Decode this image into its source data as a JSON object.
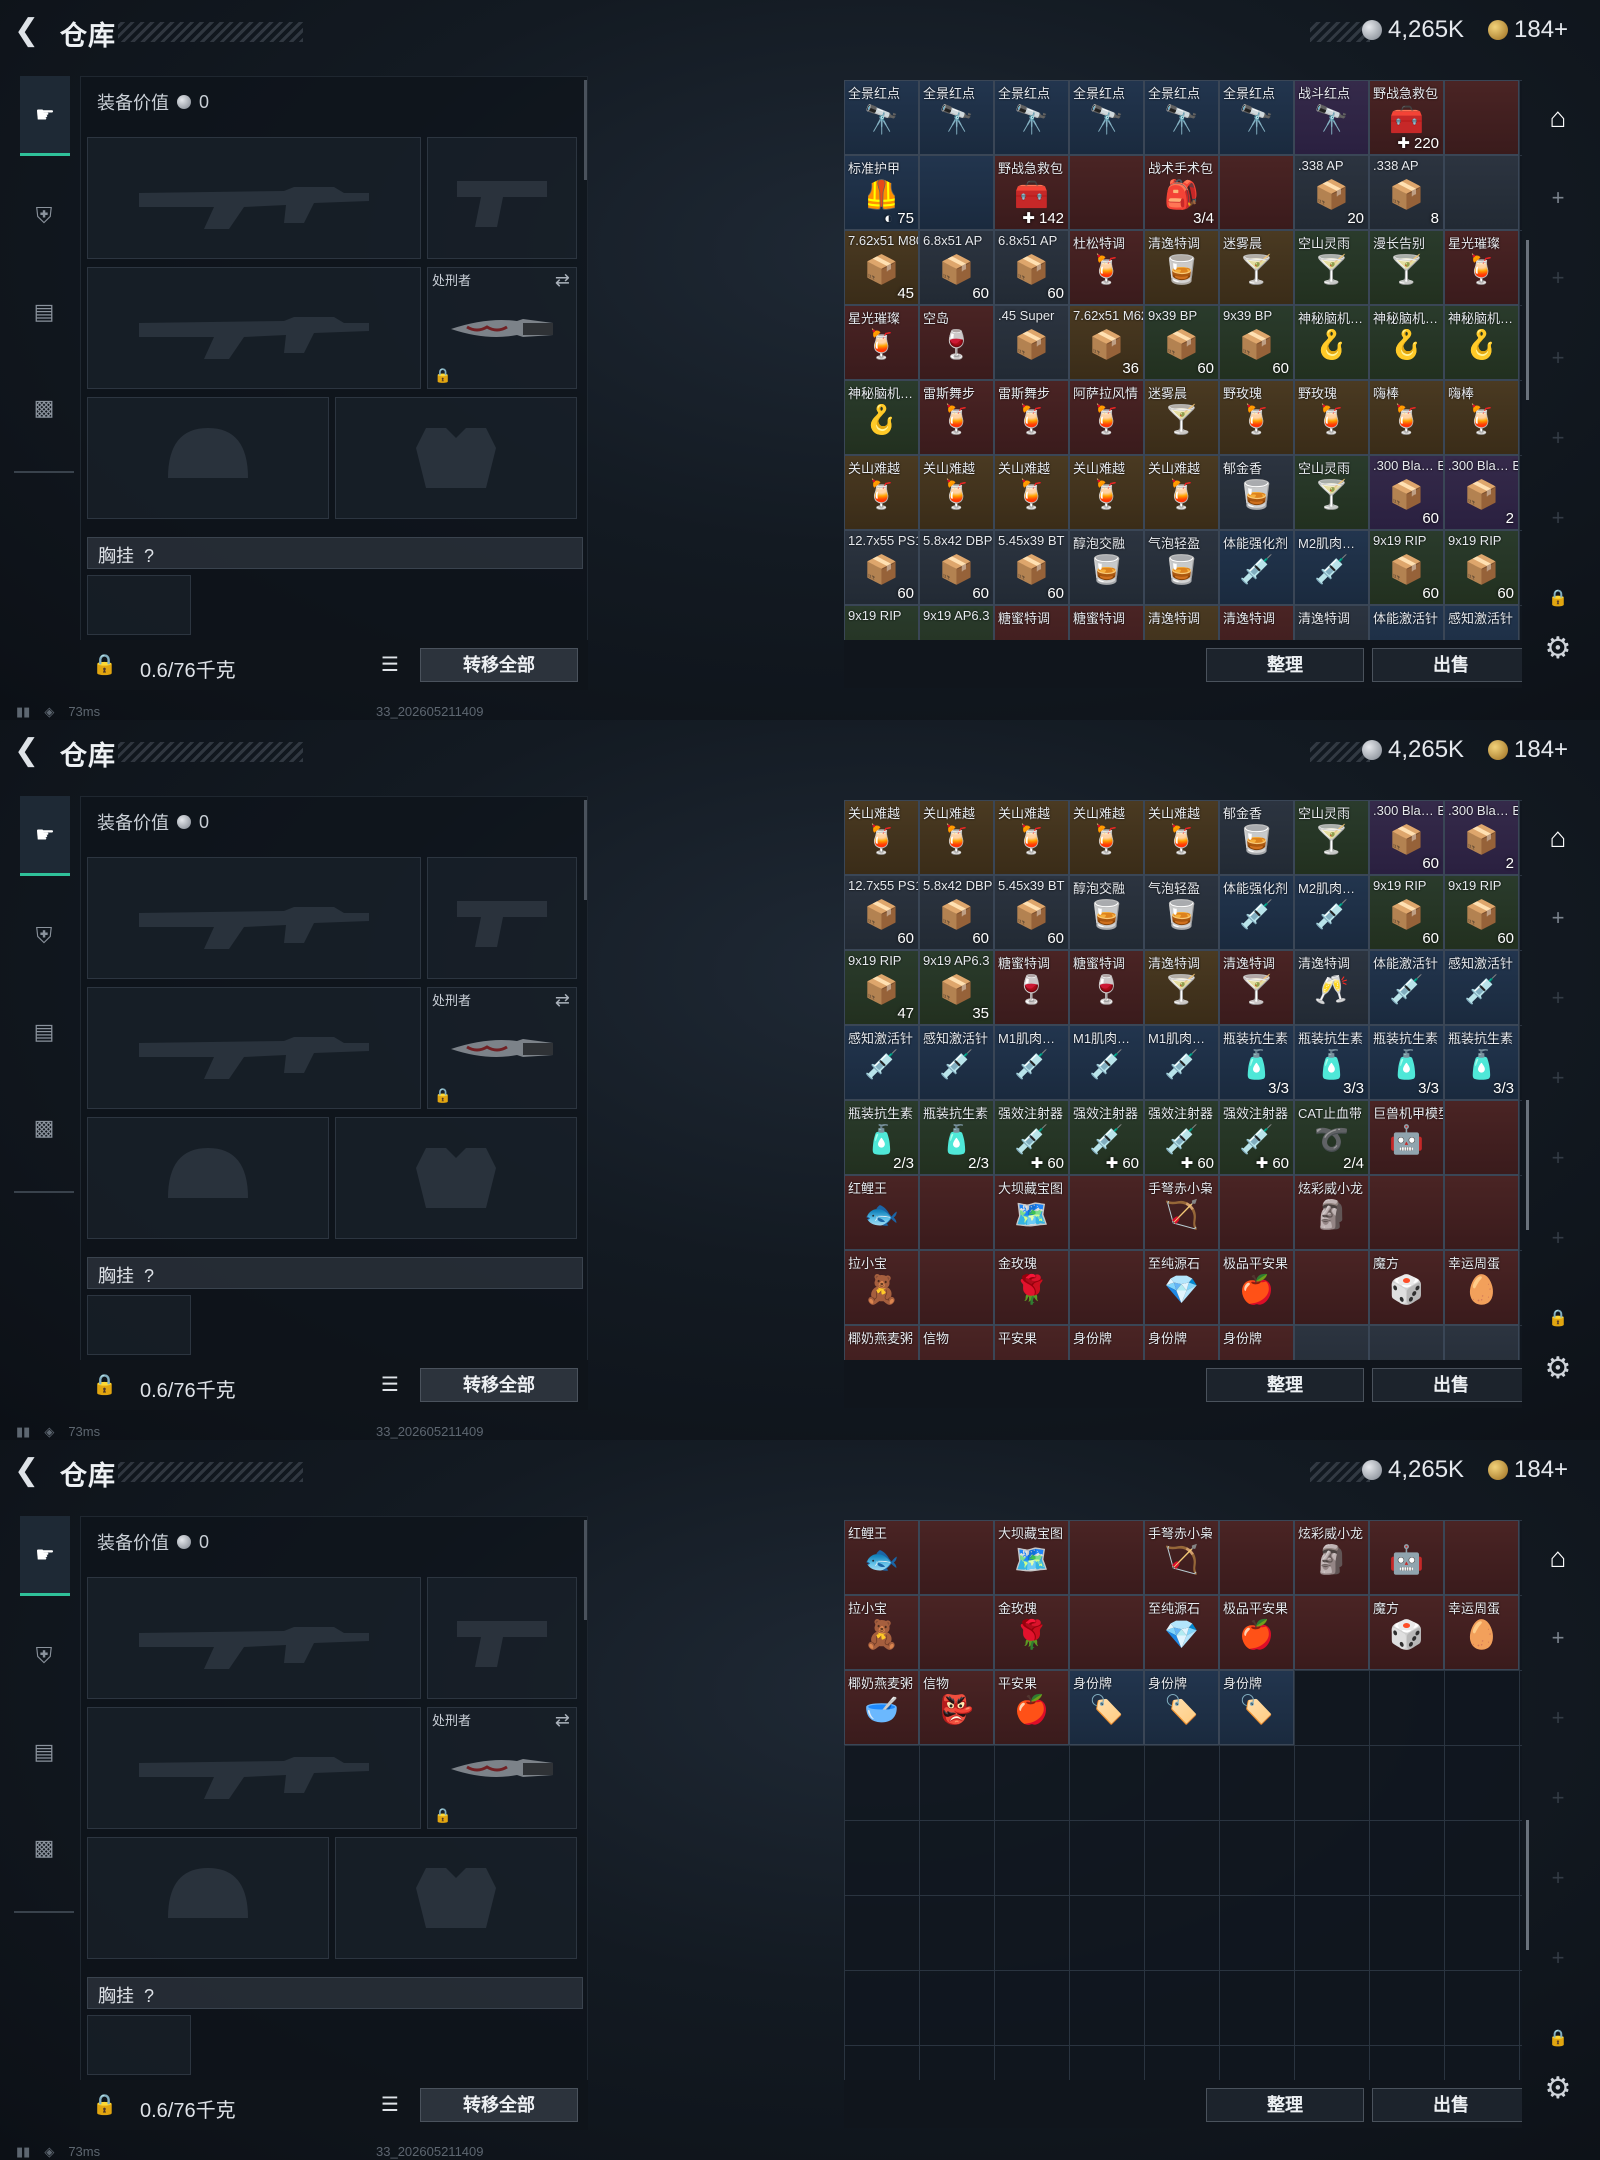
{
  "screens": [
    {
      "stash_cells": [
        {
          "n": "全景红点",
          "c": "",
          "t": "bl",
          "i": "🔭"
        },
        {
          "n": "全景红点",
          "c": "",
          "t": "bl",
          "i": "🔭"
        },
        {
          "n": "全景红点",
          "c": "",
          "t": "bl",
          "i": "🔭"
        },
        {
          "n": "全景红点",
          "c": "",
          "t": "bl",
          "i": "🔭"
        },
        {
          "n": "全景红点",
          "c": "",
          "t": "bl",
          "i": "🔭"
        },
        {
          "n": "全景红点",
          "c": "",
          "t": "bl",
          "i": "🔭"
        },
        {
          "n": "战斗红点",
          "c": "",
          "t": "pr",
          "i": "🔭"
        },
        {
          "n": "野战急救包",
          "c": "✚ 220",
          "t": "rd",
          "i": "🧰"
        },
        {
          "n": "",
          "c": "",
          "t": "rd",
          "i": ""
        },
        {
          "n": "标准护甲",
          "c": "◐ 75",
          "t": "bl",
          "i": "🦺"
        },
        {
          "n": "",
          "c": "",
          "t": "bl",
          "i": ""
        },
        {
          "n": "野战急救包",
          "c": "✚ 142",
          "t": "rd",
          "i": "🧰"
        },
        {
          "n": "",
          "c": "",
          "t": "rd",
          "i": ""
        },
        {
          "n": "战术手术包",
          "c": "3/4",
          "t": "rd",
          "i": "🎒"
        },
        {
          "n": "",
          "c": "",
          "t": "rd",
          "i": ""
        },
        {
          "n": ".338 AP",
          "c": "20",
          "t": "gy",
          "i": "📦"
        },
        {
          "n": ".338 AP",
          "c": "8",
          "t": "gy",
          "i": "📦"
        },
        {
          "n": "",
          "c": "",
          "t": "gy",
          "i": ""
        },
        {
          "n": "7.62x51 M80",
          "c": "45",
          "t": "gd",
          "i": "📦"
        },
        {
          "n": "6.8x51 AP",
          "c": "60",
          "t": "gy",
          "i": "📦"
        },
        {
          "n": "6.8x51 AP",
          "c": "60",
          "t": "gy",
          "i": "📦"
        },
        {
          "n": "杜松特调",
          "c": "",
          "t": "rd",
          "i": "🍹"
        },
        {
          "n": "清逸特调",
          "c": "",
          "t": "gd",
          "i": "🥃"
        },
        {
          "n": "迷雾晨",
          "c": "",
          "t": "gd",
          "i": "🍸"
        },
        {
          "n": "空山灵雨",
          "c": "",
          "t": "gn",
          "i": "🍸"
        },
        {
          "n": "漫长告别",
          "c": "",
          "t": "gn",
          "i": "🍸"
        },
        {
          "n": "星光璀璨",
          "c": "",
          "t": "rd",
          "i": "🍹"
        },
        {
          "n": "星光璀璨",
          "c": "",
          "t": "rd",
          "i": "🍹"
        },
        {
          "n": "空岛",
          "c": "",
          "t": "rd",
          "i": "🍷"
        },
        {
          "n": ".45 Super",
          "c": "",
          "t": "gy",
          "i": "📦"
        },
        {
          "n": "7.62x51 M62",
          "c": "36",
          "t": "gd",
          "i": "📦"
        },
        {
          "n": "9x39 BP",
          "c": "60",
          "t": "gn",
          "i": "📦"
        },
        {
          "n": "9x39 BP",
          "c": "60",
          "t": "gn",
          "i": "📦"
        },
        {
          "n": "神秘脑机…",
          "c": "",
          "t": "gn",
          "i": "🪝"
        },
        {
          "n": "神秘脑机…",
          "c": "",
          "t": "gn",
          "i": "🪝"
        },
        {
          "n": "神秘脑机…",
          "c": "",
          "t": "gn",
          "i": "🪝"
        },
        {
          "n": "神秘脑机…",
          "c": "",
          "t": "gn",
          "i": "🪝"
        },
        {
          "n": "雷斯舞步",
          "c": "",
          "t": "rd",
          "i": "🍹"
        },
        {
          "n": "雷斯舞步",
          "c": "",
          "t": "rd",
          "i": "🍹"
        },
        {
          "n": "阿萨拉风情",
          "c": "",
          "t": "rd",
          "i": "🍹"
        },
        {
          "n": "迷雾晨",
          "c": "",
          "t": "gd",
          "i": "🍸"
        },
        {
          "n": "野玫瑰",
          "c": "",
          "t": "gd",
          "i": "🍹"
        },
        {
          "n": "野玫瑰",
          "c": "",
          "t": "gd",
          "i": "🍹"
        },
        {
          "n": "嗨棒",
          "c": "",
          "t": "gd",
          "i": "🍹"
        },
        {
          "n": "嗨棒",
          "c": "",
          "t": "gd",
          "i": "🍹"
        },
        {
          "n": "关山难越",
          "c": "",
          "t": "gd",
          "i": "🍹"
        },
        {
          "n": "关山难越",
          "c": "",
          "t": "gd",
          "i": "🍹"
        },
        {
          "n": "关山难越",
          "c": "",
          "t": "gd",
          "i": "🍹"
        },
        {
          "n": "关山难越",
          "c": "",
          "t": "gd",
          "i": "🍹"
        },
        {
          "n": "关山难越",
          "c": "",
          "t": "gd",
          "i": "🍹"
        },
        {
          "n": "郁金香",
          "c": "",
          "t": "gy",
          "i": "🥃"
        },
        {
          "n": "空山灵雨",
          "c": "",
          "t": "gn",
          "i": "🍸"
        },
        {
          "n": ".300 Bla… BCP SUB",
          "c": "60",
          "t": "pr",
          "i": "📦"
        },
        {
          "n": ".300 Bla… BCP SUB",
          "c": "2",
          "t": "pr",
          "i": "📦"
        },
        {
          "n": "12.7x55 PS12A",
          "c": "60",
          "t": "gy",
          "i": "📦"
        },
        {
          "n": "5.8x42 DBP10",
          "c": "60",
          "t": "gy",
          "i": "📦"
        },
        {
          "n": "5.45x39 BT",
          "c": "60",
          "t": "gy",
          "i": "📦"
        },
        {
          "n": "醇泡交融",
          "c": "",
          "t": "gy",
          "i": "🥃"
        },
        {
          "n": "气泡轻盈",
          "c": "",
          "t": "gy",
          "i": "🥃"
        },
        {
          "n": "体能强化剂",
          "c": "",
          "t": "bl",
          "i": "💉"
        },
        {
          "n": "M2肌肉…",
          "c": "",
          "t": "bl",
          "i": "💉"
        },
        {
          "n": "9x19 RIP",
          "c": "60",
          "t": "gn",
          "i": "📦"
        },
        {
          "n": "9x19 RIP",
          "c": "60",
          "t": "gn",
          "i": "📦"
        },
        {
          "n": "9x19 RIP",
          "c": "",
          "t": "gn",
          "i": ""
        },
        {
          "n": "9x19 AP6.3",
          "c": "",
          "t": "gn",
          "i": ""
        },
        {
          "n": "糖蜜特调",
          "c": "",
          "t": "rd",
          "i": ""
        },
        {
          "n": "糖蜜特调",
          "c": "",
          "t": "rd",
          "i": ""
        },
        {
          "n": "清逸特调",
          "c": "",
          "t": "gd",
          "i": ""
        },
        {
          "n": "清逸特调",
          "c": "",
          "t": "rd",
          "i": ""
        },
        {
          "n": "清逸特调",
          "c": "",
          "t": "gy",
          "i": ""
        },
        {
          "n": "体能激活针",
          "c": "",
          "t": "bl",
          "i": ""
        },
        {
          "n": "感知激活针",
          "c": "",
          "t": "bl",
          "i": ""
        }
      ]
    },
    {
      "stash_cells": [
        {
          "n": "关山难越",
          "c": "",
          "t": "gd",
          "i": "🍹"
        },
        {
          "n": "关山难越",
          "c": "",
          "t": "gd",
          "i": "🍹"
        },
        {
          "n": "关山难越",
          "c": "",
          "t": "gd",
          "i": "🍹"
        },
        {
          "n": "关山难越",
          "c": "",
          "t": "gd",
          "i": "🍹"
        },
        {
          "n": "关山难越",
          "c": "",
          "t": "gd",
          "i": "🍹"
        },
        {
          "n": "郁金香",
          "c": "",
          "t": "gy",
          "i": "🥃"
        },
        {
          "n": "空山灵雨",
          "c": "",
          "t": "gn",
          "i": "🍸"
        },
        {
          "n": ".300 Bla… BCP SUB",
          "c": "60",
          "t": "pr",
          "i": "📦"
        },
        {
          "n": ".300 Bla… BCP SUB",
          "c": "2",
          "t": "pr",
          "i": "📦"
        },
        {
          "n": "12.7x55 PS12A",
          "c": "60",
          "t": "gy",
          "i": "📦"
        },
        {
          "n": "5.8x42 DBP10",
          "c": "60",
          "t": "gy",
          "i": "📦"
        },
        {
          "n": "5.45x39 BT",
          "c": "60",
          "t": "gy",
          "i": "📦"
        },
        {
          "n": "醇泡交融",
          "c": "",
          "t": "gy",
          "i": "🥃"
        },
        {
          "n": "气泡轻盈",
          "c": "",
          "t": "gy",
          "i": "🥃"
        },
        {
          "n": "体能强化剂",
          "c": "",
          "t": "bl",
          "i": "💉"
        },
        {
          "n": "M2肌肉…",
          "c": "",
          "t": "bl",
          "i": "💉"
        },
        {
          "n": "9x19 RIP",
          "c": "60",
          "t": "gn",
          "i": "📦"
        },
        {
          "n": "9x19 RIP",
          "c": "60",
          "t": "gn",
          "i": "📦"
        },
        {
          "n": "9x19 RIP",
          "c": "47",
          "t": "gn",
          "i": "📦"
        },
        {
          "n": "9x19 AP6.3",
          "c": "35",
          "t": "gn",
          "i": "📦"
        },
        {
          "n": "糖蜜特调",
          "c": "",
          "t": "rd",
          "i": "🍷"
        },
        {
          "n": "糖蜜特调",
          "c": "",
          "t": "rd",
          "i": "🍷"
        },
        {
          "n": "清逸特调",
          "c": "",
          "t": "gd",
          "i": "🍸"
        },
        {
          "n": "清逸特调",
          "c": "",
          "t": "rd",
          "i": "🍸"
        },
        {
          "n": "清逸特调",
          "c": "",
          "t": "gy",
          "i": "🥂"
        },
        {
          "n": "体能激活针",
          "c": "",
          "t": "bl",
          "i": "💉"
        },
        {
          "n": "感知激活针",
          "c": "",
          "t": "bl",
          "i": "💉"
        },
        {
          "n": "感知激活针",
          "c": "",
          "t": "bl",
          "i": "💉"
        },
        {
          "n": "感知激活针",
          "c": "",
          "t": "bl",
          "i": "💉"
        },
        {
          "n": "M1肌肉…",
          "c": "",
          "t": "bl",
          "i": "💉"
        },
        {
          "n": "M1肌肉…",
          "c": "",
          "t": "bl",
          "i": "💉"
        },
        {
          "n": "M1肌肉…",
          "c": "",
          "t": "bl",
          "i": "💉"
        },
        {
          "n": "瓶装抗生素",
          "c": "3/3",
          "t": "bl",
          "i": "🧴"
        },
        {
          "n": "瓶装抗生素",
          "c": "3/3",
          "t": "bl",
          "i": "🧴"
        },
        {
          "n": "瓶装抗生素",
          "c": "3/3",
          "t": "bl",
          "i": "🧴"
        },
        {
          "n": "瓶装抗生素",
          "c": "3/3",
          "t": "bl",
          "i": "🧴"
        },
        {
          "n": "瓶装抗生素",
          "c": "2/3",
          "t": "gn",
          "i": "🧴"
        },
        {
          "n": "瓶装抗生素",
          "c": "2/3",
          "t": "gn",
          "i": "🧴"
        },
        {
          "n": "强效注射器",
          "c": "✚ 60",
          "t": "gn",
          "i": "💉"
        },
        {
          "n": "强效注射器",
          "c": "✚ 60",
          "t": "gn",
          "i": "💉"
        },
        {
          "n": "强效注射器",
          "c": "✚ 60",
          "t": "gn",
          "i": "💉"
        },
        {
          "n": "强效注射器",
          "c": "✚ 60",
          "t": "gn",
          "i": "💉"
        },
        {
          "n": "CAT止血带",
          "c": "2/4",
          "t": "gn",
          "i": "➰"
        },
        {
          "n": "巨兽机甲模型",
          "c": "",
          "t": "rd",
          "i": "🤖"
        },
        {
          "n": "",
          "c": "",
          "t": "rd",
          "i": ""
        },
        {
          "n": "红鲤王",
          "c": "",
          "t": "rd",
          "i": "🐟"
        },
        {
          "n": "",
          "c": "",
          "t": "rd",
          "i": ""
        },
        {
          "n": "大坝藏宝图",
          "c": "",
          "t": "rd",
          "i": "🗺️"
        },
        {
          "n": "",
          "c": "",
          "t": "rd",
          "i": ""
        },
        {
          "n": "手弩赤小枭",
          "c": "",
          "t": "rd",
          "i": "🏹"
        },
        {
          "n": "",
          "c": "",
          "t": "rd",
          "i": ""
        },
        {
          "n": "炫彩威小龙",
          "c": "",
          "t": "rd",
          "i": "🗿"
        },
        {
          "n": "",
          "c": "",
          "t": "rd",
          "i": ""
        },
        {
          "n": "",
          "c": "",
          "t": "rd",
          "i": ""
        },
        {
          "n": "拉小宝",
          "c": "",
          "t": "rd",
          "i": "🧸"
        },
        {
          "n": "",
          "c": "",
          "t": "rd",
          "i": ""
        },
        {
          "n": "金玫瑰",
          "c": "",
          "t": "rd",
          "i": "🌹"
        },
        {
          "n": "",
          "c": "",
          "t": "rd",
          "i": ""
        },
        {
          "n": "至纯源石",
          "c": "",
          "t": "rd",
          "i": "💎"
        },
        {
          "n": "极品平安果",
          "c": "",
          "t": "rd",
          "i": "🍎"
        },
        {
          "n": "",
          "c": "",
          "t": "rd",
          "i": ""
        },
        {
          "n": "魔方",
          "c": "",
          "t": "rd",
          "i": "🎲"
        },
        {
          "n": "幸运周蛋",
          "c": "",
          "t": "rd",
          "i": "🥚"
        },
        {
          "n": "椰奶燕麦粥",
          "c": "",
          "t": "rd",
          "i": ""
        },
        {
          "n": "信物",
          "c": "",
          "t": "rd",
          "i": ""
        },
        {
          "n": "平安果",
          "c": "",
          "t": "rd",
          "i": ""
        },
        {
          "n": "身份牌",
          "c": "",
          "t": "rd",
          "i": ""
        },
        {
          "n": "身份牌",
          "c": "",
          "t": "rd",
          "i": ""
        },
        {
          "n": "身份牌",
          "c": "",
          "t": "rd",
          "i": ""
        },
        {
          "n": "",
          "c": "",
          "t": "gy",
          "i": ""
        },
        {
          "n": "",
          "c": "",
          "t": "gy",
          "i": ""
        },
        {
          "n": "",
          "c": "",
          "t": "gy",
          "i": ""
        }
      ]
    },
    {
      "stash_cells": [
        {
          "n": "红鲤王",
          "c": "",
          "t": "rd",
          "i": "🐟"
        },
        {
          "n": "",
          "c": "",
          "t": "rd",
          "i": ""
        },
        {
          "n": "大坝藏宝图",
          "c": "",
          "t": "rd",
          "i": "🗺️"
        },
        {
          "n": "",
          "c": "",
          "t": "rd",
          "i": ""
        },
        {
          "n": "手弩赤小枭",
          "c": "",
          "t": "rd",
          "i": "🏹"
        },
        {
          "n": "",
          "c": "",
          "t": "rd",
          "i": ""
        },
        {
          "n": "炫彩威小龙",
          "c": "",
          "t": "rd",
          "i": "🗿"
        },
        {
          "n": "",
          "c": "",
          "t": "rd",
          "i": "🤖"
        },
        {
          "n": "",
          "c": "",
          "t": "rd",
          "i": ""
        },
        {
          "n": "拉小宝",
          "c": "",
          "t": "rd",
          "i": "🧸"
        },
        {
          "n": "",
          "c": "",
          "t": "rd",
          "i": ""
        },
        {
          "n": "金玫瑰",
          "c": "",
          "t": "rd",
          "i": "🌹"
        },
        {
          "n": "",
          "c": "",
          "t": "rd",
          "i": ""
        },
        {
          "n": "至纯源石",
          "c": "",
          "t": "rd",
          "i": "💎"
        },
        {
          "n": "极品平安果",
          "c": "",
          "t": "rd",
          "i": "🍎"
        },
        {
          "n": "",
          "c": "",
          "t": "rd",
          "i": ""
        },
        {
          "n": "魔方",
          "c": "",
          "t": "rd",
          "i": "🎲"
        },
        {
          "n": "幸运周蛋",
          "c": "",
          "t": "rd",
          "i": "🥚"
        },
        {
          "n": "椰奶燕麦粥",
          "c": "",
          "t": "rd",
          "i": "🥣"
        },
        {
          "n": "信物",
          "c": "",
          "t": "rd",
          "i": "👺"
        },
        {
          "n": "平安果",
          "c": "",
          "t": "rd",
          "i": "🍎"
        },
        {
          "n": "身份牌",
          "c": "",
          "t": "bl",
          "i": "🏷️"
        },
        {
          "n": "身份牌",
          "c": "",
          "t": "bl",
          "i": "🏷️"
        },
        {
          "n": "身份牌",
          "c": "",
          "t": "bl",
          "i": "🏷️"
        }
      ]
    }
  ],
  "common": {
    "page_title": "仓库",
    "currency_silver": "4,265K",
    "currency_gold": "184+",
    "equip_value_label": "装备价值",
    "equip_value": "0",
    "melee_slot_label": "处刑者",
    "chest_label": "胸挂",
    "chest_help": "?",
    "weight": "0.6/76千克",
    "transfer_all": "转移全部",
    "sort_button": "整理",
    "sell_button": "出售",
    "ping": "73ms",
    "build": "33_202605211409"
  },
  "colors": {
    "accent": "#2fc19a"
  }
}
